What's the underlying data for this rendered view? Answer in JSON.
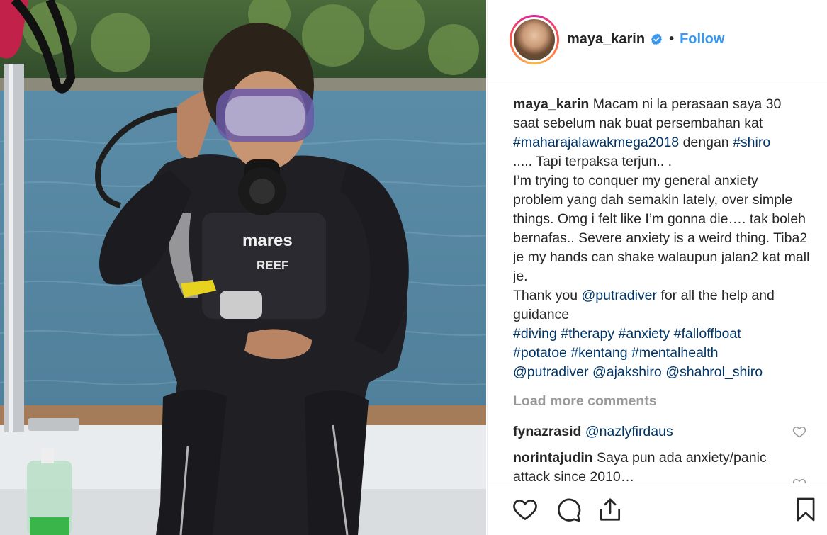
{
  "media": {
    "brand_text": "mares",
    "model_text": "REEF"
  },
  "header": {
    "username": "maya_karin",
    "separator": "•",
    "follow_label": "Follow"
  },
  "caption": {
    "author": "maya_karin",
    "text1": " Macam ni la perasaan saya 30 saat sebelum nak buat persembahan kat ",
    "tag_maharaja": "#maharajalawakmega2018",
    "text2": " dengan ",
    "tag_shiro": "#shiro",
    "text3": "..... Tapi terpaksa terjun.. .",
    "text4": "I’m trying to conquer my general anxiety problem yang dah semakin lately, over simple things. Omg i felt like I’m gonna die…. tak boleh bernafas.. Severe anxiety is a weird thing. Tiba2 je my hands can shake walaupun jalan2 kat mall je.",
    "text5a": "Thank you ",
    "mention_putradiver": "@putradiver",
    "text5b": " for all the help and guidance",
    "hashtags": [
      "#diving",
      "#therapy",
      "#anxiety",
      "#falloffboat",
      "#potatoe",
      "#kentang",
      "#mentalhealth"
    ],
    "mentions": [
      "@putradiver",
      "@ajakshiro",
      "@shahrol_shiro"
    ]
  },
  "load_more_label": "Load more comments",
  "comments": [
    {
      "author": "fynazrasid",
      "mention": "@nazlyfirdaus",
      "text": ""
    },
    {
      "author": "norintajudin",
      "mention": "",
      "text": " Saya pun ada anxiety/panic attack since 2010…"
    }
  ],
  "actions": {
    "like_icon": "heart-icon",
    "comment_icon": "comment-bubble-icon",
    "share_icon": "share-icon",
    "save_icon": "bookmark-icon"
  },
  "colors": {
    "link": "#003569",
    "follow": "#3897f0",
    "verified": "#3897f0",
    "muted": "#999999"
  }
}
